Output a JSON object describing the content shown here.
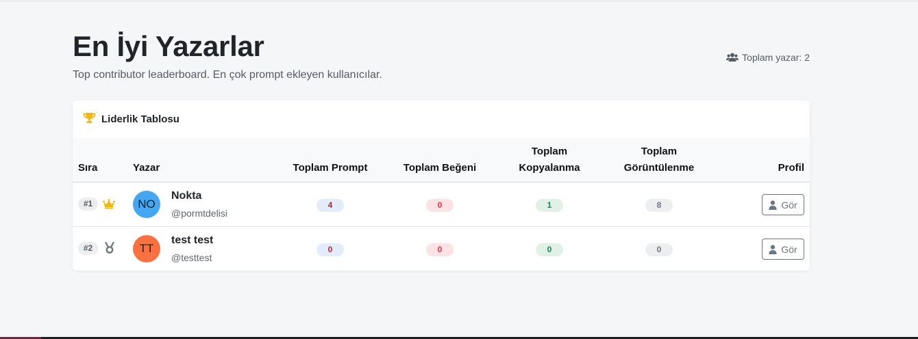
{
  "header": {
    "title": "En İyi Yazarlar",
    "subtitle": "Top contributor leaderboard. En çok prompt ekleyen kullanıcılar.",
    "total_authors": "Toplam yazar: 2",
    "total_icon": "users-icon"
  },
  "card": {
    "title": "Liderlik Tablosu",
    "title_icon": "trophy-icon"
  },
  "table": {
    "headers": {
      "rank": "Sıra",
      "author": "Yazar",
      "prompts": "Toplam Prompt",
      "likes": "Toplam Beğeni",
      "copies_line1": "Toplam",
      "copies_line2": "Kopyalanma",
      "views_line1": "Toplam",
      "views_line2": "Görüntülenme",
      "profile": "Profil"
    },
    "rows": [
      {
        "rank": "#1",
        "rank_icon": "crown-icon",
        "initials": "NO",
        "avatar_color": "#45a6f2",
        "name": "Nokta",
        "handle": "@pormtdelisi",
        "prompts": "4",
        "likes": "0",
        "copies": "1",
        "views": "8",
        "view_label": "Gör",
        "view_icon": "user-icon"
      },
      {
        "rank": "#2",
        "rank_icon": "medal-icon",
        "initials": "TT",
        "avatar_color": "#ff7040",
        "name": "test test",
        "handle": "@testtest",
        "prompts": "0",
        "likes": "0",
        "copies": "0",
        "views": "0",
        "view_label": "Gör",
        "view_icon": "user-icon"
      }
    ]
  },
  "colors": {
    "background": "#f5f6f8",
    "gold": "#f5b50a",
    "prompt_pill": "#e3ecfa",
    "likes_pill": "#fbe3e5",
    "copies_pill": "#e1f1e7",
    "views_pill": "#eceef0"
  }
}
